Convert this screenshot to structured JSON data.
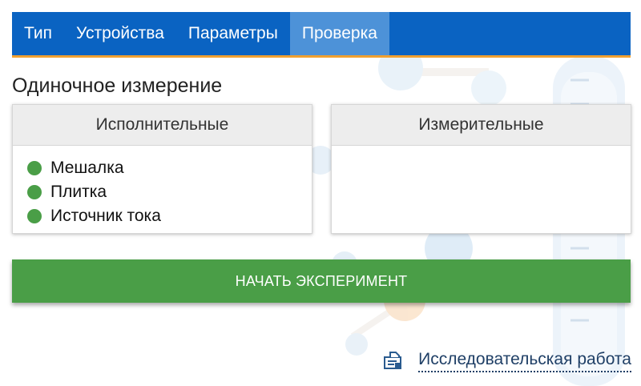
{
  "nav": {
    "tabs": [
      {
        "label": "Тип",
        "active": false
      },
      {
        "label": "Устройства",
        "active": false
      },
      {
        "label": "Параметры",
        "active": false
      },
      {
        "label": "Проверка",
        "active": true
      }
    ],
    "accent_color": "#0a63c2",
    "active_tab_color": "#4d92d8",
    "underline_color": "#f0a030"
  },
  "page": {
    "title": "Одиночное измерение"
  },
  "panels": {
    "actuators": {
      "header": "Исполнительные",
      "items": [
        {
          "label": "Мешалка",
          "status": "ok",
          "status_color": "#4a9e47"
        },
        {
          "label": "Плитка",
          "status": "ok",
          "status_color": "#4a9e47"
        },
        {
          "label": "Источник тока",
          "status": "ok",
          "status_color": "#4a9e47"
        }
      ]
    },
    "sensors": {
      "header": "Измерительные",
      "items": []
    }
  },
  "actions": {
    "start_label": "НАЧАТЬ ЭКСПЕРИМЕНТ",
    "start_color": "#4a9e47"
  },
  "footer": {
    "research_link": "Исследовательская работа",
    "research_icon": "document-icon"
  }
}
